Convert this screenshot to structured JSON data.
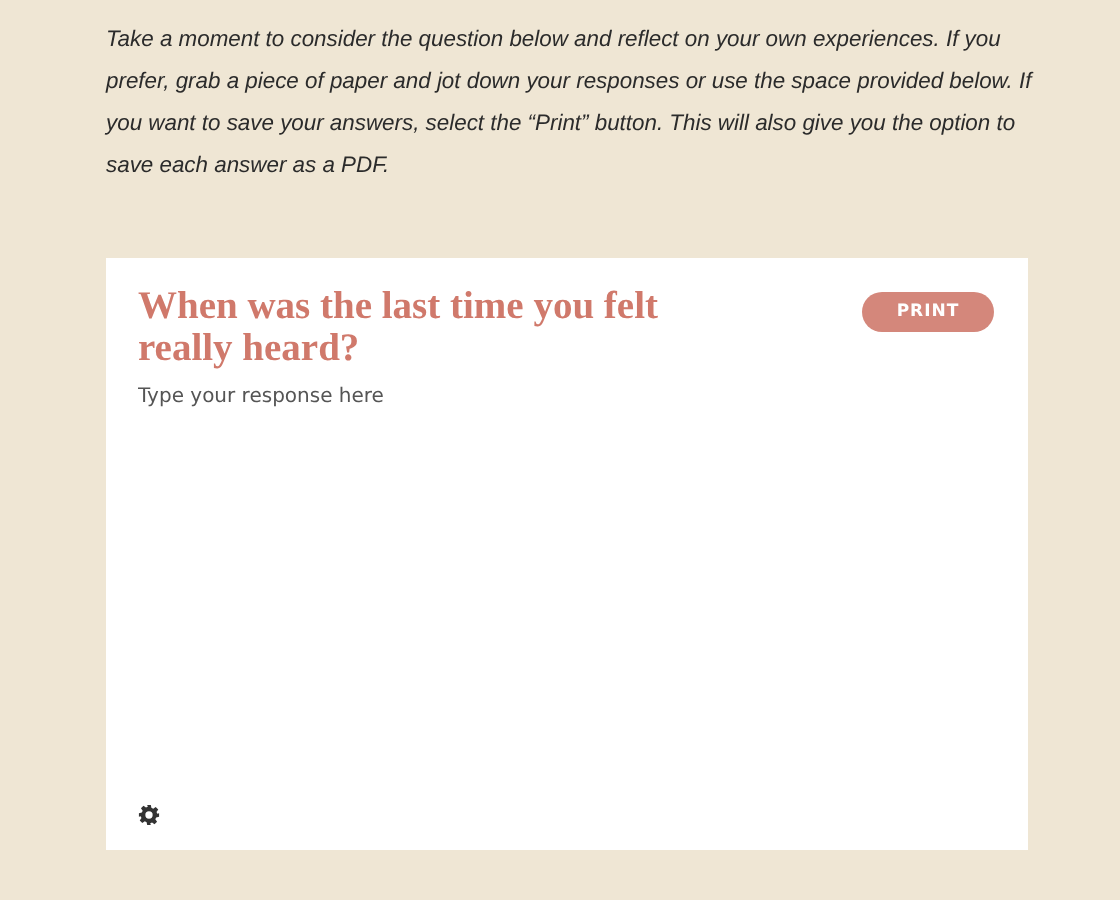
{
  "intro": "Take a moment to consider the question below and reflect on your own experiences. If you prefer, grab a piece of paper and jot down your responses or use the space provided below. If you want to save your answers, select the “Print” button. This will also give you the option to save each answer as a PDF.",
  "card": {
    "question": "When was the last time you felt really heard?",
    "print_button": "PRINT",
    "response": {
      "placeholder": "Type your response here"
    }
  }
}
